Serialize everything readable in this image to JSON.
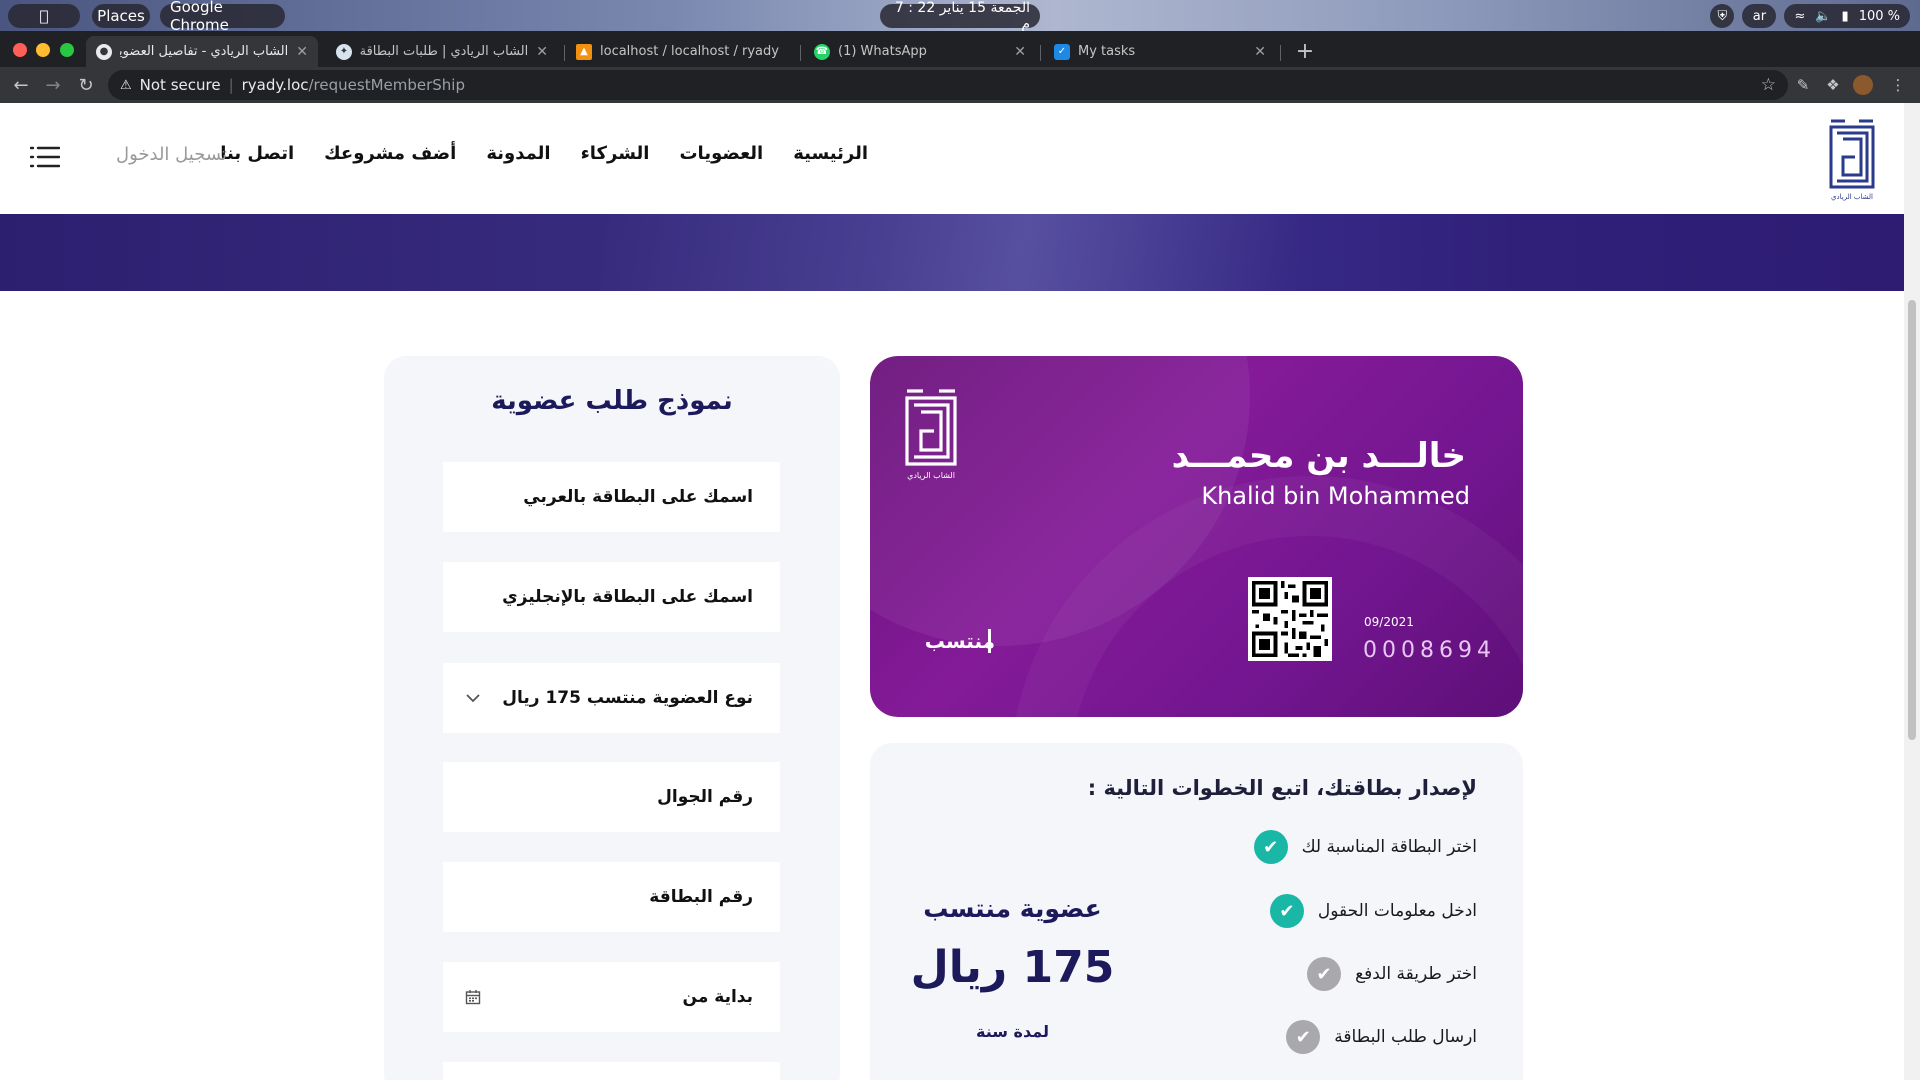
{
  "os": {
    "places": "Places",
    "app": "Google Chrome",
    "clock": "الجمعة 15 يناير  22 : 7 م",
    "lang": "ar",
    "battery": "100 %"
  },
  "tabs": [
    {
      "title": "الشاب الريادي - تفاصيل العضويات",
      "active": true
    },
    {
      "title": "الشاب الريادي | طلبات البطاقة ال",
      "active": false
    },
    {
      "title": "localhost / localhost / ryady",
      "active": false
    },
    {
      "title": "(1) WhatsApp",
      "active": false
    },
    {
      "title": "My tasks",
      "active": false
    }
  ],
  "address": {
    "security": "Not secure",
    "host": "ryady.loc",
    "path": "/requestMemberShip"
  },
  "nav": {
    "items": [
      "الرئيسية",
      "العضويات",
      "الشركاء",
      "المدونة",
      "أضف مشروعك",
      "اتصل بنا"
    ],
    "login": "تسجيل الدخول"
  },
  "form": {
    "title": "نموذج طلب عضوية",
    "fields": [
      {
        "label": "اسمك على البطاقة بالعربي"
      },
      {
        "label": "اسمك على البطاقة بالإنجليزي"
      },
      {
        "label": "نوع العضوية منتسب 175 ريال",
        "trail_icon": "chevron-down-icon"
      },
      {
        "label": "رقم الجوال"
      },
      {
        "label": "رقم البطاقة"
      },
      {
        "label": "بداية من",
        "trail_icon": "calendar-icon"
      }
    ]
  },
  "card": {
    "logo_caption": "الشاب الريادي",
    "name_ar": "خالـــد بن محمـــد",
    "name_en": "Khalid bin Mohammed",
    "date": "09/2021",
    "number": "0008694",
    "tier": "منتسب",
    "colors": {
      "start": "#6a127a",
      "end": "#5e0f78"
    }
  },
  "steps": {
    "title": "لإصدار بطاقتك، اتبع الخطوات التالية :",
    "items": [
      {
        "label": "اختر البطاقة المناسبة لك",
        "done": true
      },
      {
        "label": "ادخل معلومات الحقول",
        "done": true
      },
      {
        "label": "اختر طريقة الدفع",
        "done": false
      },
      {
        "label": "ارسال طلب البطاقة",
        "done": false
      }
    ],
    "price_title": "عضوية منتسب",
    "price_value": "175 ريال",
    "price_sub": "لمدة سنة"
  },
  "colors": {
    "brand_navy": "#1d1a5c",
    "accent_teal": "#1bb7a6",
    "banner": "#362a7c"
  }
}
